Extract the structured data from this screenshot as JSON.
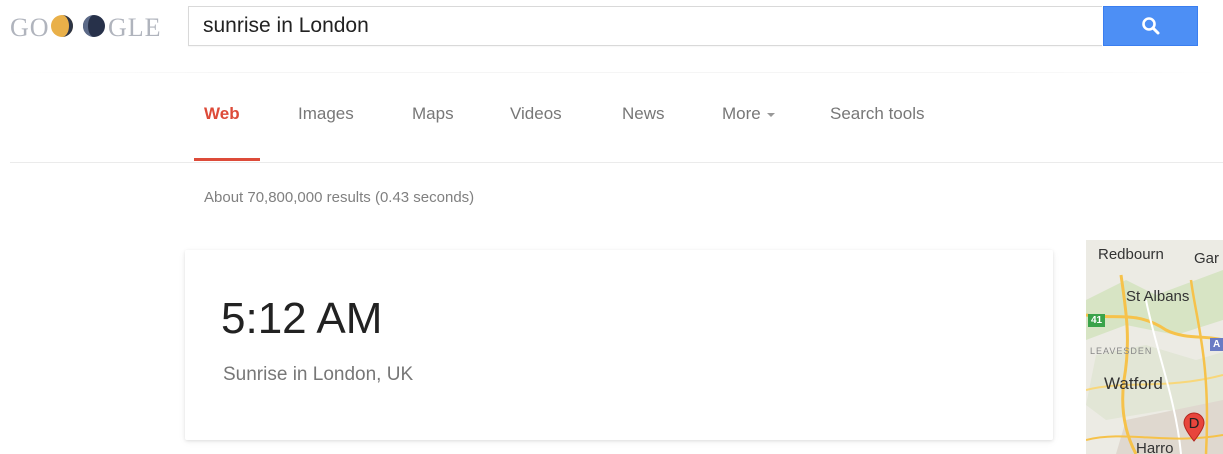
{
  "header": {
    "logo_text": "GOOGLE",
    "search": {
      "value": "sunrise in London",
      "placeholder": ""
    },
    "search_button_icon": "search-icon"
  },
  "tabs": [
    {
      "label": "Web",
      "active": true
    },
    {
      "label": "Images",
      "active": false
    },
    {
      "label": "Maps",
      "active": false
    },
    {
      "label": "Videos",
      "active": false
    },
    {
      "label": "News",
      "active": false
    },
    {
      "label": "More",
      "active": false,
      "icon": "caret-down-icon"
    },
    {
      "label": "Search tools",
      "active": false
    }
  ],
  "results": {
    "stats": "About 70,800,000 results (0.43 seconds)"
  },
  "answer_card": {
    "time": "5:12 AM",
    "description": "Sunrise in London, UK"
  },
  "map": {
    "labels": {
      "redbourn": "Redbourn",
      "gar": "Gar",
      "st_albans": "St Albans",
      "leavesden": "LEAVESDEN",
      "watford": "Watford",
      "harrow": "Harro",
      "marker": "D",
      "road_green": "41",
      "road_blue": "A"
    }
  },
  "colors": {
    "accent_red": "#dd4b39",
    "search_blue": "#4d8ff5",
    "muted_text": "#777777"
  }
}
